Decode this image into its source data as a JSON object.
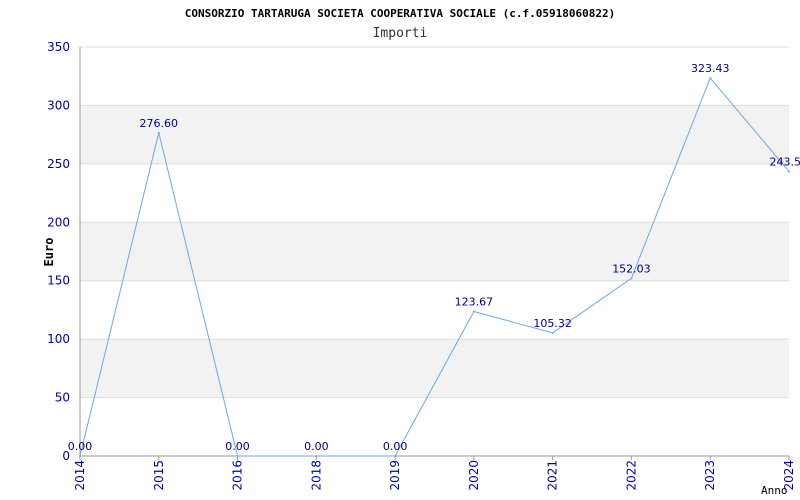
{
  "chart_data": {
    "type": "line",
    "title": "CONSORZIO TARTARUGA SOCIETA COOPERATIVA SOCIALE (c.f.05918060822)",
    "subtitle": "Importi",
    "xlabel": "Anno",
    "ylabel": "Euro",
    "x": [
      "2014",
      "2015",
      "2016",
      "2018",
      "2019",
      "2020",
      "2021",
      "2022",
      "2023",
      "2024"
    ],
    "values": [
      0.0,
      276.6,
      0.0,
      0.0,
      0.0,
      123.67,
      105.32,
      152.03,
      323.43,
      243.5
    ],
    "data_labels": [
      "0.00",
      "276.60",
      "0.00",
      "0.00",
      "0.00",
      "123.67",
      "105.32",
      "152.03",
      "323.43",
      "243.5"
    ],
    "ylim": [
      0,
      350
    ],
    "yticks": [
      "0",
      "50",
      "100",
      "150",
      "200",
      "250",
      "300",
      "350"
    ],
    "grid": true,
    "colors": {
      "line": "#6aa9e8",
      "band": "#f2f2f2",
      "tick_text": "#0000aa",
      "data_label": "#00008b",
      "title": "#000000"
    }
  }
}
